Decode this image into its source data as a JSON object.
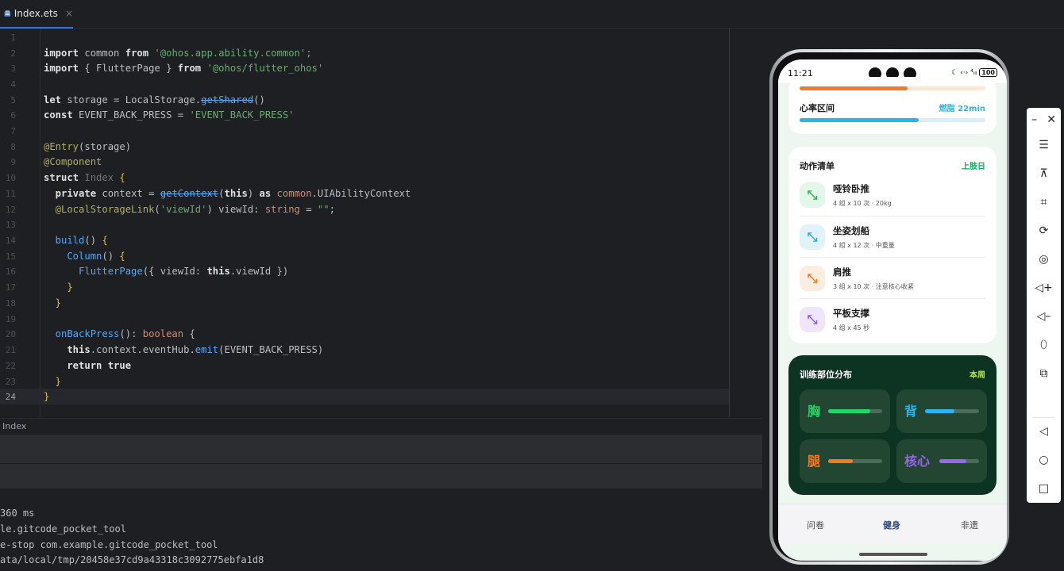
{
  "tab": {
    "file_name": "Index.ets",
    "close_glyph": "×"
  },
  "editor": {
    "line_numbers": [
      "1",
      "2",
      "3",
      "4",
      "5",
      "6",
      "7",
      "8",
      "9",
      "10",
      "11",
      "12",
      "13",
      "14",
      "15",
      "16",
      "17",
      "18",
      "19",
      "20",
      "21",
      "22",
      "23",
      "24"
    ],
    "l2": [
      "import",
      " common ",
      "from",
      " '@ohos.app.ability.common';"
    ],
    "l3": [
      "import",
      " { FlutterPage } ",
      "from",
      " '@ohos/flutter_ohos'"
    ],
    "l5": [
      "let",
      " storage = LocalStorage.",
      "getShared",
      "()"
    ],
    "l6": [
      "const",
      " EVENT_BACK_PRESS = ",
      "'EVENT_BACK_PRESS'"
    ],
    "l8": [
      "@Entry",
      "(storage)"
    ],
    "l9": [
      "@Component"
    ],
    "l10": [
      "struct",
      " Index ",
      "{"
    ],
    "l11": [
      "  private",
      " context = ",
      "getContext",
      "(",
      "this",
      ") ",
      "as",
      " common",
      ".UIAbilityContext"
    ],
    "l12": [
      "  @LocalStorageLink",
      "(",
      "'viewId'",
      ") viewId: ",
      "string",
      " = ",
      "\"\"",
      ";"
    ],
    "l14": [
      "  build",
      "() ",
      "{"
    ],
    "l15": [
      "    Column",
      "() ",
      "{"
    ],
    "l16": [
      "      FlutterPage",
      "({ viewId: ",
      "this",
      ".viewId })"
    ],
    "l17": [
      "    }"
    ],
    "l18": [
      "  }"
    ],
    "l20": [
      "  onBackPress",
      "(): ",
      "boolean",
      " {"
    ],
    "l21": [
      "    this",
      ".context.eventHub.",
      "emit",
      "(EVENT_BACK_PRESS)"
    ],
    "l22": [
      "    return",
      " ",
      "true"
    ],
    "l23": [
      "  }"
    ],
    "l24": [
      "}"
    ]
  },
  "panel": {
    "tab_label": "Index",
    "log": [
      "360 ms",
      "le.gitcode_pocket_tool",
      "e-stop com.example.gitcode_pocket_tool",
      "ata/local/tmp/20458e37cd9a43318c3092775ebfa1d8"
    ]
  },
  "phone": {
    "status_time": "11:21",
    "status_icons": "☾ ‹·› ⁴ᵢₗₗ",
    "battery": "100",
    "top_card": {
      "progress_fraction": 0.58,
      "heart_label": "心率区间",
      "burn_label": "燃脂 22min",
      "heart_fraction": 0.64
    },
    "exercise_card": {
      "title": "动作清单",
      "link": "上肢日",
      "items": [
        {
          "name": "哑铃卧推",
          "detail": "4 组 x 10 次 · 20kg",
          "icon": "arrows-icon",
          "color": "#27b14f"
        },
        {
          "name": "坐姿划船",
          "detail": "4 组 x 12 次 · 中重量",
          "icon": "arrows-icon",
          "color": "#2aa8dd"
        },
        {
          "name": "肩推",
          "detail": "3 组 x 10 次 · 注意核心收紧",
          "icon": "arrows-icon",
          "color": "#f0782a"
        },
        {
          "name": "平板支撑",
          "detail": "4 组 x 45 秒",
          "icon": "arrows-icon",
          "color": "#8e5ae6"
        }
      ],
      "icon_glyph": "⤡"
    },
    "distribution_card": {
      "title": "训练部位分布",
      "link": "本周",
      "tiles": [
        {
          "label": "胸",
          "fraction": 0.78,
          "color": "#21d46b"
        },
        {
          "label": "背",
          "fraction": 0.55,
          "color": "#2bb5f0"
        },
        {
          "label": "腿",
          "fraction": 0.45,
          "color": "#f27a22"
        },
        {
          "label": "核心",
          "fraction": 0.68,
          "color": "#9a66f0"
        }
      ]
    },
    "nav": {
      "left": "问卷",
      "center": "健身",
      "right": "非遗"
    }
  },
  "sidebar": {
    "minimize": "–",
    "close": "✕",
    "menu": "☰",
    "pin": "⊼",
    "crop": "⌗",
    "rotate": "⟳",
    "screenshot": "◎",
    "volume_up": "◁+",
    "volume_down": "◁–",
    "shake": "⬯",
    "fold": "⧉",
    "back": "◁",
    "home": "○",
    "recents": "□"
  }
}
